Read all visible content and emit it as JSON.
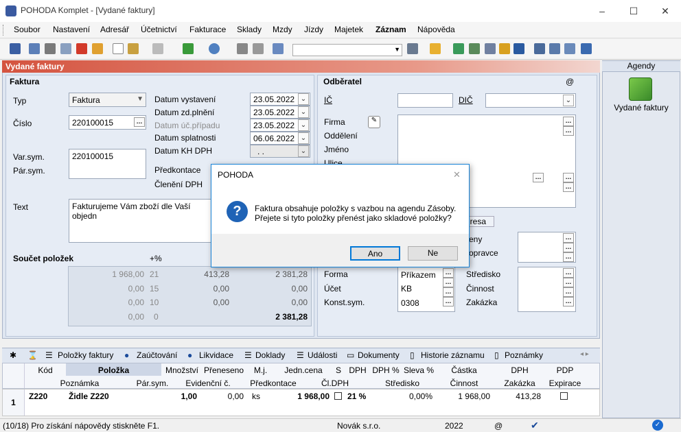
{
  "window": {
    "title": "POHODA Komplet - [Vydané faktury]",
    "min": "–",
    "max": "☐",
    "close": "✕"
  },
  "menu": [
    "Soubor",
    "Nastavení",
    "Adresář",
    "Účetnictví",
    "Fakturace",
    "Sklady",
    "Mzdy",
    "Jízdy",
    "Majetek",
    "Záznam",
    "Nápověda"
  ],
  "pane": {
    "title": "Vydané faktury"
  },
  "faktura": {
    "section": "Faktura",
    "typ_label": "Typ",
    "typ_value": "Faktura",
    "cislo_label": "Číslo",
    "cislo_value": "220100015",
    "varsym_label": "Var.sym.",
    "varsym_value": "220100015",
    "parsym_label": "Pár.sym.",
    "text_label": "Text",
    "text_value": "Fakturujeme Vám zboží dle Vaší objedn"
  },
  "dates": {
    "vystaveni_label": "Datum vystavení",
    "vystaveni": "23.05.2022",
    "zdplneni_label": "Datum zd.plnění",
    "zdplneni": "23.05.2022",
    "ucpripadu_label": "Datum úč.případu",
    "ucpripadu": "23.05.2022",
    "splatnosti_label": "Datum splatnosti",
    "splatnosti": "06.06.2022",
    "khdph_label": "Datum KH DPH",
    "khdph": ". .",
    "predkontace_label": "Předkontace",
    "cleneni_label": "Členění DPH"
  },
  "soucet": {
    "title": "Součet položek",
    "pct_label": "+%",
    "rows": [
      [
        "1 968,00",
        "21",
        "413,28",
        "2 381,28"
      ],
      [
        "0,00",
        "15",
        "0,00",
        "0,00"
      ],
      [
        "0,00",
        "10",
        "0,00",
        "0,00"
      ],
      [
        "0,00",
        "0",
        "",
        ""
      ]
    ],
    "total": "2 381,28"
  },
  "odberatel": {
    "section": "Odběratel",
    "at": "@",
    "ic_label": "IČ",
    "dic_label": "DIČ",
    "firma_label": "Firma",
    "oddeleni_label": "Oddělení",
    "jmeno_label": "Jméno",
    "ulice_label": "Ulice",
    "adresa_tab": "dresa",
    "ceny_label": "eny",
    "dopravce_label": "opravce",
    "forma_label": "Forma",
    "forma_value": "Příkazem",
    "ucet_label": "Účet",
    "ucet_value": "KB",
    "konst_label": "Konst.sym.",
    "konst_value": "0308",
    "stredisko_label": "Středisko",
    "cinnost_label": "Činnost",
    "zakazka_label": "Zakázka"
  },
  "agendy": {
    "title": "Agendy",
    "item": "Vydané faktury"
  },
  "tabs": [
    "Položky faktury",
    "Zaúčtování",
    "Likvidace",
    "Doklady",
    "Události",
    "Dokumenty",
    "Historie záznamu",
    "Poznámky"
  ],
  "grid": {
    "headers1": [
      "Kód",
      "Položka",
      "Množství",
      "Přeneseno",
      "M.j.",
      "Jedn.cena",
      "S",
      "DPH",
      "DPH %",
      "Sleva %",
      "Částka",
      "DPH",
      "PDP"
    ],
    "headers2": [
      "Poznámka",
      "Pár.sym.",
      "Evidenční č.",
      "Předkontace",
      "Čl.DPH",
      "Středisko",
      "Činnost",
      "Zakázka",
      "Expirace"
    ],
    "row": {
      "index": "1",
      "kod": "Z220",
      "polozka": "Židle Z220",
      "mnozstvi": "1,00",
      "preneseno": "0,00",
      "mj": "ks",
      "cena": "1 968,00",
      "dph": "21 %",
      "sleva": "0,00%",
      "castka": "1 968,00",
      "dph_val": "413,28"
    }
  },
  "status": {
    "hint": "(10/18) Pro získání nápovědy stiskněte F1.",
    "company": "Novák s.r.o.",
    "year": "2022",
    "at": "@"
  },
  "dialog": {
    "title": "POHODA",
    "message1": "Faktura obsahuje položky s vazbou na agendu Zásoby.",
    "message2": "Přejete si tyto položky přenést jako skladové položky?",
    "yes": "Ano",
    "no": "Ne",
    "close": "✕"
  }
}
